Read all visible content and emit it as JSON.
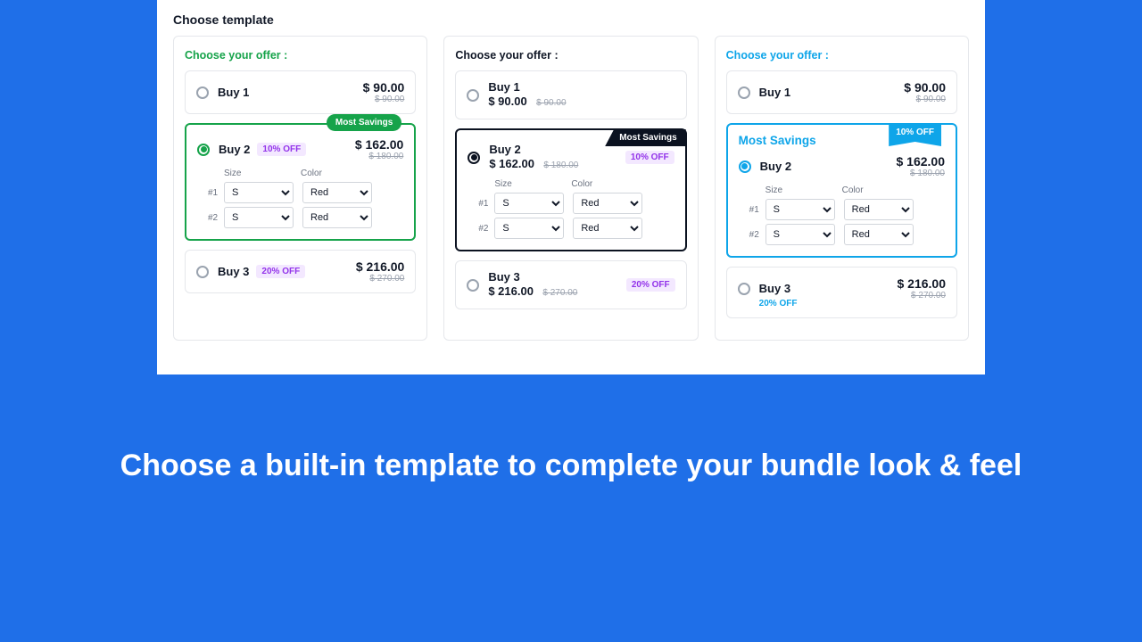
{
  "header": {
    "title": "Choose template"
  },
  "labels": {
    "choose_offer": "Choose your offer :",
    "size": "Size",
    "color": "Color",
    "idx1": "#1",
    "idx2": "#2",
    "most_savings": "Most Savings"
  },
  "offers": {
    "buy1": {
      "name": "Buy 1",
      "price": "$ 90.00",
      "strike": "$ 90.00"
    },
    "buy2": {
      "name": "Buy 2",
      "price": "$ 162.00",
      "strike": "$ 180.00",
      "off": "10% OFF"
    },
    "buy3": {
      "name": "Buy 3",
      "price": "$ 216.00",
      "strike": "$ 270.00",
      "off": "20% OFF"
    }
  },
  "variant": {
    "size": "S",
    "color": "Red"
  },
  "tagline": "Choose a built-in template to complete your bundle look & feel"
}
